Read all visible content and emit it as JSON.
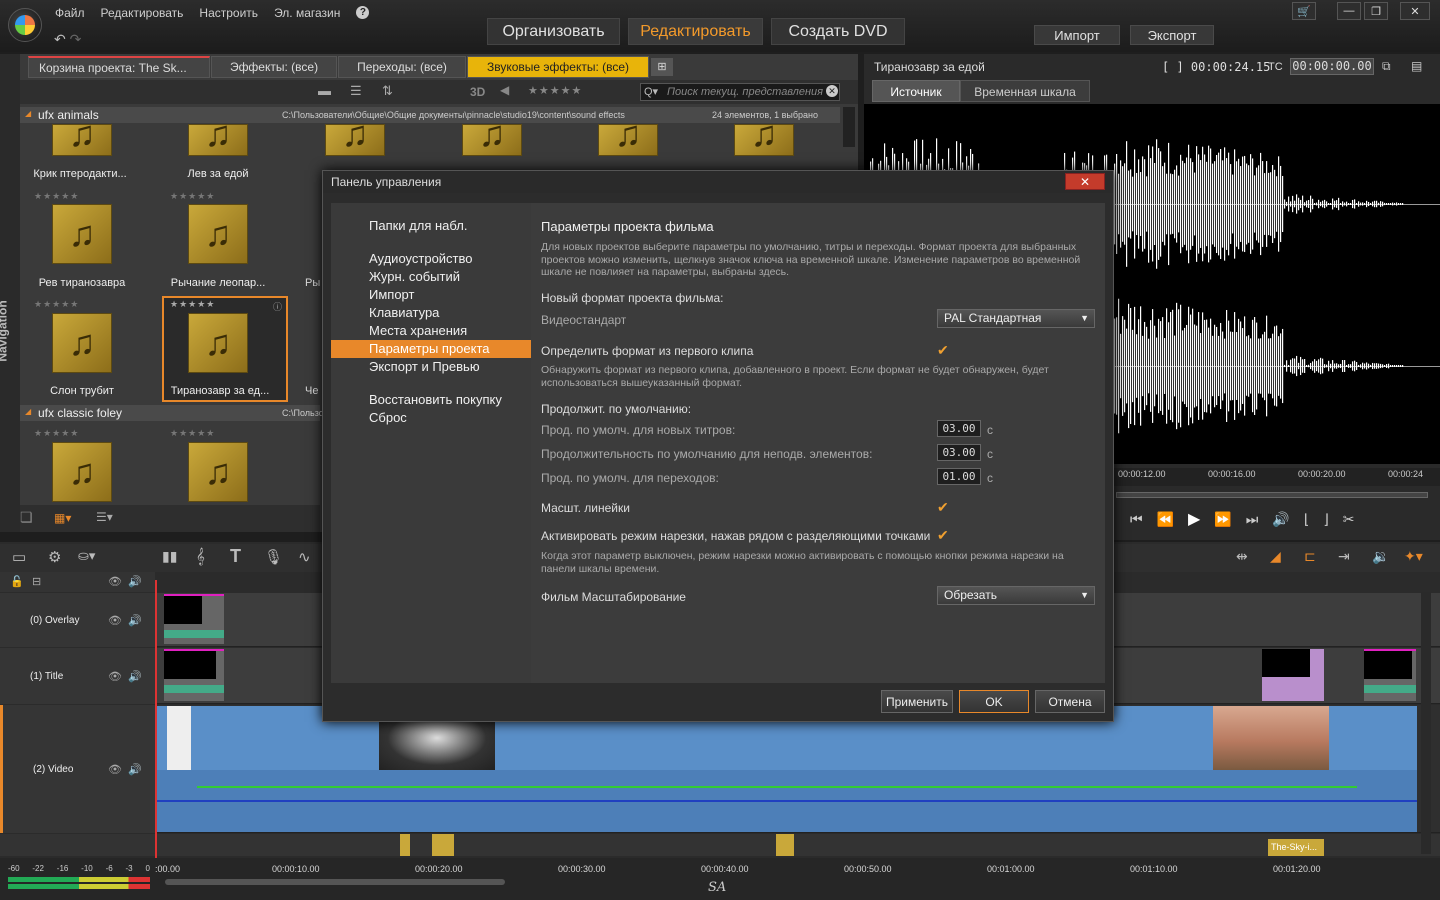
{
  "menu": {
    "file": "Файл",
    "edit": "Редактировать",
    "settings": "Настроить",
    "store": "Эл. магазин",
    "help": "?"
  },
  "modes": {
    "organize": "Организовать",
    "edit": "Редактировать",
    "dvd": "Создать DVD",
    "import": "Импорт",
    "export": "Экспорт"
  },
  "library": {
    "tabs": [
      "Корзина проекта: The Sk...",
      "Эффекты: (все)",
      "Переходы: (все)",
      "Звуковые эффекты: (все)"
    ],
    "view3d": "3D",
    "search_placeholder": "Поиск текущ. представления",
    "group1": {
      "name": "ufx animals",
      "path": "C:\\Пользователи\\Общие\\Общие документы\\pinnacle\\studio19\\content\\sound effects",
      "count": "24 элементов, 1 выбрано"
    },
    "group2": {
      "name": "ufx classic foley",
      "path": "C:\\Пользо"
    },
    "items": [
      "Крик птеродакти...",
      "Лев за едой",
      "Рев тиранозавра",
      "Рычание леопар...",
      "Слон трубит",
      "Тиранозавр за ед..."
    ],
    "partial": [
      "Ры",
      "Че"
    ],
    "nav_label": "Navigation"
  },
  "player": {
    "title": "Тиранозавр за едой",
    "duration": "[ ] 00:00:24.15",
    "tc_label": "TC",
    "timecode": "00:00:00.00",
    "tab_source": "Источник",
    "tab_timeline": "Временная шкала",
    "ruler": [
      "00:00:12.00",
      "00:00:16.00",
      "00:00:20.00",
      "00:00:24"
    ]
  },
  "timeline": {
    "tracks": [
      "(0) Overlay",
      "(1) Title",
      "(2) Video"
    ],
    "ruler": [
      ":00.00",
      "00:00:10.00",
      "00:00:20.00",
      "00:00:30.00",
      "00:00:40.00",
      "00:00:50.00",
      "00:01:00.00",
      "00:01:10.00",
      "00:01:20.00"
    ],
    "meter": [
      "-60",
      "-22",
      "-16",
      "-10",
      "-6",
      "-3",
      "0"
    ],
    "audio_clip": "The-Sky-i...",
    "watermark": "SA"
  },
  "dialog": {
    "title": "Панель управления",
    "close": "✕",
    "nav": [
      "Папки для набл.",
      "Аудиоустройство",
      "Журн. событий",
      "Импорт",
      "Клавиатура",
      "Места хранения",
      "Параметры проекта",
      "Экспорт и Превью",
      "Восстановить покупку",
      "Сброс"
    ],
    "heading": "Параметры проекта фильма",
    "intro": "Для новых проектов выберите параметры по умолчанию, титры и переходы. Формат проекта для выбранных проектов можно изменить, щелкнув значок ключа на временной шкале. Изменение параметров во временной шкале не повлияет на параметры, выбраны здесь.",
    "new_format": "Новый формат проекта фильма:",
    "video_std_label": "Видеостандарт",
    "video_std_value": "PAL Стандартная",
    "detect_label": "Определить формат из первого клипа",
    "detect_desc": "Обнаружить формат из первого клипа, добавленного в проект. Если формат не будет обнаружен, будет использоваться вышеуказанный формат.",
    "durations_label": "Продолжит. по умолчанию:",
    "dur_titles_label": "Прод. по умолч. для новых титров:",
    "dur_titles": "03.00",
    "dur_still_label": "Продолжительность по умолчанию для неподв. элементов:",
    "dur_still": "03.00",
    "dur_trans_label": "Прод. по умолч. для переходов:",
    "dur_trans": "01.00",
    "unit": "с",
    "scale_ruler": "Масшт. линейки",
    "trim_label": "Активировать режим нарезки, нажав рядом с разделяющими точками",
    "trim_desc": "Когда этот параметр выключен, режим нарезки можно активировать с помощью кнопки режима нарезки на панели шкалы времени.",
    "film_scale_label": "Фильм Масштабирование",
    "film_scale_value": "Обрезать",
    "check": "✔",
    "apply": "Применить",
    "ok": "OK",
    "cancel": "Отмена"
  },
  "colors": {
    "accent": "#e8882a",
    "tab_active": "#e8b40a",
    "close": "#c43b2b"
  }
}
